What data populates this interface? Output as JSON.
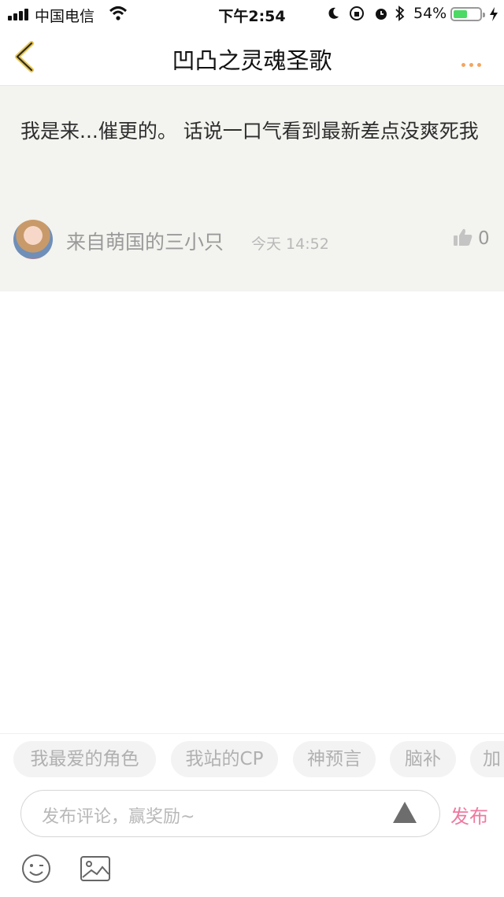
{
  "status_bar": {
    "carrier": "中国电信",
    "time": "下午2:54",
    "battery_percent": "54%",
    "battery_level": 0.54,
    "icons": [
      "signal-icon",
      "wifi-icon",
      "moon-icon",
      "rotation-lock-icon",
      "alarm-icon",
      "bluetooth-icon",
      "battery-icon",
      "charging-icon"
    ]
  },
  "nav": {
    "back_icon": "chevron-left-icon",
    "title": "凹凸之灵魂圣歌",
    "more_icon": "more-dots-icon"
  },
  "comment": {
    "text": "我是来...催更的。 话说一口气看到最新差点没爽死我",
    "username": "来自萌国的三小只",
    "timestamp": "今天 14:52",
    "like_count": "0",
    "like_icon": "thumbs-up-icon"
  },
  "tags": [
    "我最爱的角色",
    "我站的CP",
    "神预言",
    "脑补",
    "加"
  ],
  "composer": {
    "placeholder": "发布评论，赢奖励~",
    "publish_label": "发布",
    "emoji_icon": "emoji-icon",
    "image_icon": "image-icon",
    "warning_icon": "triangle-icon"
  },
  "colors": {
    "accent_orange": "#f4a560",
    "publish_pink": "#ee7aa0",
    "comment_bg": "#f3f3ef",
    "battery_green": "#4cd964"
  }
}
